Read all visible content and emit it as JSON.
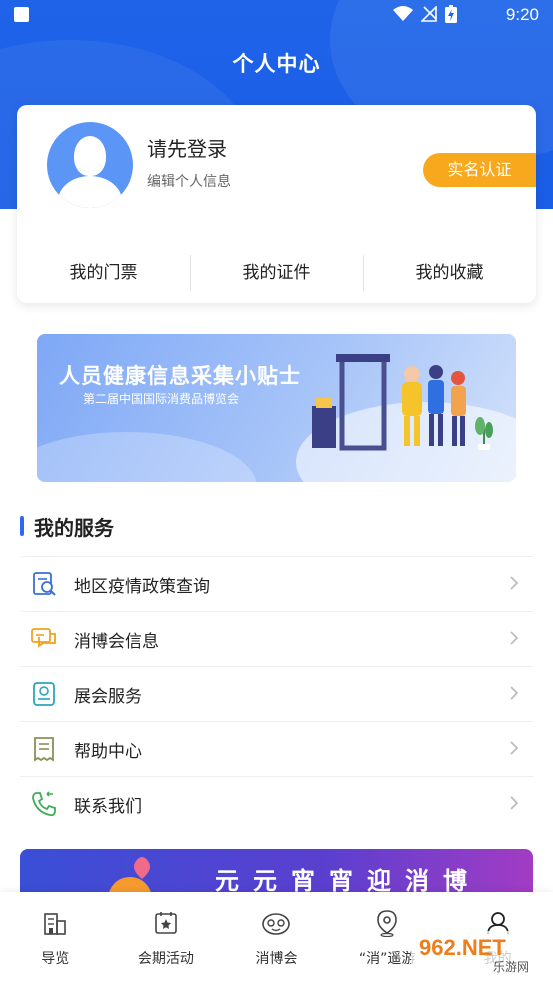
{
  "status_bar": {
    "time": "9:20"
  },
  "header": {
    "title": "个人中心"
  },
  "profile": {
    "login_prompt": "请先登录",
    "edit_info": "编辑个人信息",
    "verify_button": "实名认证"
  },
  "quick_tabs": [
    {
      "label": "我的门票"
    },
    {
      "label": "我的证件"
    },
    {
      "label": "我的收藏"
    }
  ],
  "banner": {
    "title": "人员健康信息采集小贴士",
    "subtitle": "第二届中国国际消费品博览会"
  },
  "services": {
    "title": "我的服务",
    "items": [
      {
        "label": "地区疫情政策查询",
        "icon": "search-doc-icon"
      },
      {
        "label": "消博会信息",
        "icon": "chat-icon"
      },
      {
        "label": "展会服务",
        "icon": "service-card-icon"
      },
      {
        "label": "帮助中心",
        "icon": "receipt-icon"
      },
      {
        "label": "联系我们",
        "icon": "phone-icon"
      }
    ]
  },
  "bottom_banner": {
    "text": "元元宵宵迎消博"
  },
  "bottom_nav": [
    {
      "label": "导览",
      "icon": "building-icon"
    },
    {
      "label": "会期活动",
      "icon": "star-calendar-icon"
    },
    {
      "label": "消博会",
      "icon": "mascot-icon"
    },
    {
      "label": "“消”遥游",
      "icon": "location-icon"
    },
    {
      "label": "我的",
      "icon": "user-icon"
    }
  ],
  "watermark": {
    "text": "962.NET",
    "sub": "乐游网"
  },
  "colors": {
    "primary": "#1e63e8",
    "accent": "#f8a81d",
    "section_bar": "#2c6bf0"
  }
}
